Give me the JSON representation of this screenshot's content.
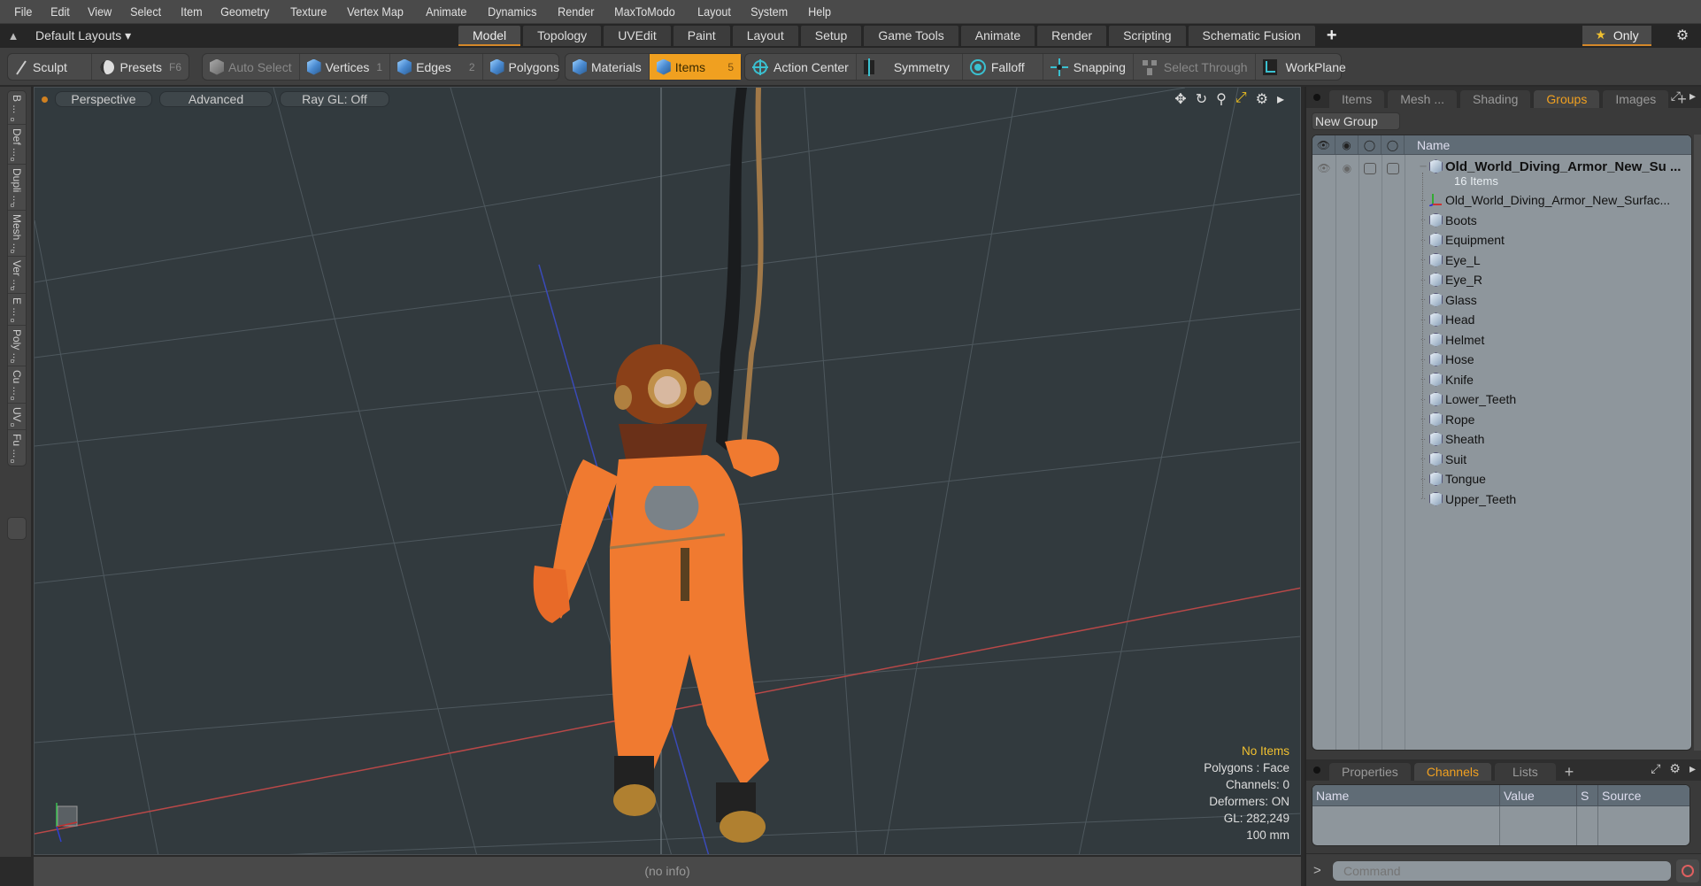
{
  "menu": [
    "File",
    "Edit",
    "View",
    "Select",
    "Item",
    "Geometry",
    "Texture",
    "Vertex Map",
    "Animate",
    "Dynamics",
    "Render",
    "MaxToModo",
    "Layout",
    "System",
    "Help"
  ],
  "layout_bar": {
    "layout_selector": "Default Layouts",
    "tabs": [
      "Model",
      "Topology",
      "UVEdit",
      "Paint",
      "Layout",
      "Setup",
      "Game Tools",
      "Animate",
      "Render",
      "Scripting",
      "Schematic Fusion"
    ],
    "active_tab": "Model",
    "only_label": "Only"
  },
  "toolbar": {
    "sculpt": "Sculpt",
    "presets": "Presets",
    "presets_key": "F6",
    "auto_select": "Auto Select",
    "vertices": "Vertices",
    "vertices_key": "1",
    "edges": "Edges",
    "edges_key": "2",
    "polygons": "Polygons",
    "materials": "Materials",
    "items": "Items",
    "items_key": "5",
    "action_center": "Action Center",
    "symmetry": "Symmetry",
    "falloff": "Falloff",
    "snapping": "Snapping",
    "select_through": "Select Through",
    "workplane": "WorkPlane"
  },
  "left_tabs": [
    "B ...",
    "Def ...",
    "Dupli ...",
    "Mesh ...",
    "Ver ...",
    "E ...",
    "Poly ...",
    "Cu ...",
    "UV",
    "Fu ..."
  ],
  "viewport": {
    "view_mode": "Perspective",
    "shading": "Advanced",
    "raygl": "Ray GL: Off",
    "info": {
      "selection": "No Items",
      "polygons": "Polygons : Face",
      "channels": "Channels: 0",
      "deformers": "Deformers: ON",
      "gl": "GL: 282,249",
      "scale": "100 mm"
    },
    "status": "(no info)"
  },
  "right_panel": {
    "tabs": [
      "Items",
      "Mesh ...",
      "Shading",
      "Groups",
      "Images"
    ],
    "active_tab": "Groups",
    "new_group": "New Group",
    "name_header": "Name",
    "group": {
      "name": "Old_World_Diving_Armor_New_Su ...",
      "count": "16 Items",
      "children": [
        {
          "name": "Old_World_Diving_Armor_New_Surfac...",
          "icon": "locator"
        },
        {
          "name": "Boots",
          "icon": "mesh"
        },
        {
          "name": "Equipment",
          "icon": "mesh"
        },
        {
          "name": "Eye_L",
          "icon": "mesh"
        },
        {
          "name": "Eye_R",
          "icon": "mesh"
        },
        {
          "name": "Glass",
          "icon": "mesh"
        },
        {
          "name": "Head",
          "icon": "mesh"
        },
        {
          "name": "Helmet",
          "icon": "mesh"
        },
        {
          "name": "Hose",
          "icon": "mesh"
        },
        {
          "name": "Knife",
          "icon": "mesh"
        },
        {
          "name": "Lower_Teeth",
          "icon": "mesh"
        },
        {
          "name": "Rope",
          "icon": "mesh"
        },
        {
          "name": "Sheath",
          "icon": "mesh"
        },
        {
          "name": "Suit",
          "icon": "mesh"
        },
        {
          "name": "Tongue",
          "icon": "mesh"
        },
        {
          "name": "Upper_Teeth",
          "icon": "mesh"
        }
      ]
    }
  },
  "bottom_panel": {
    "tabs": [
      "Properties",
      "Channels",
      "Lists"
    ],
    "active_tab": "Channels",
    "columns": [
      "Name",
      "Value",
      "S",
      "Source"
    ],
    "command_placeholder": "Command"
  },
  "colors": {
    "accent": "#f0a020",
    "viewport_bg": "#323a3e",
    "suit": "#f07a30"
  }
}
